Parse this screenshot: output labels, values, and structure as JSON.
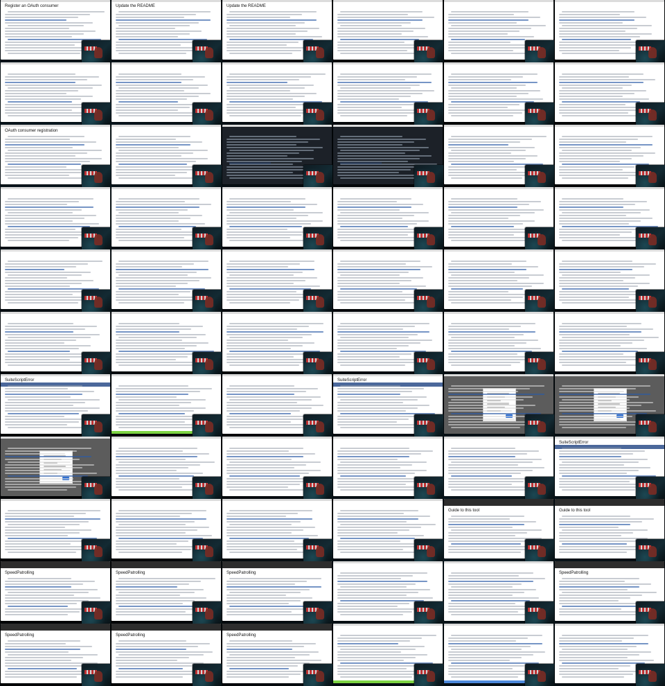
{
  "screen": {
    "label": "Contact sheet of UI screenshots"
  },
  "tiles": [
    {
      "id": "r1c1",
      "title": "Register an OAuth consumer",
      "theme": "light"
    },
    {
      "id": "r1c2",
      "title": "Update the README",
      "theme": "light"
    },
    {
      "id": "r1c3",
      "title": "Update the README",
      "theme": "light"
    },
    {
      "id": "r1c4",
      "title": "",
      "theme": "light"
    },
    {
      "id": "r1c5",
      "title": "",
      "theme": "light"
    },
    {
      "id": "r1c6",
      "title": "",
      "theme": "light"
    },
    {
      "id": "r2c1",
      "title": "",
      "theme": "light"
    },
    {
      "id": "r2c2",
      "title": "",
      "theme": "light"
    },
    {
      "id": "r2c3",
      "title": "",
      "theme": "light"
    },
    {
      "id": "r2c4",
      "title": "",
      "theme": "light"
    },
    {
      "id": "r2c5",
      "title": "",
      "theme": "light"
    },
    {
      "id": "r2c6",
      "title": "",
      "theme": "light"
    },
    {
      "id": "r3c1",
      "title": "OAuth consumer registration",
      "theme": "light"
    },
    {
      "id": "r3c2",
      "title": "",
      "theme": "light"
    },
    {
      "id": "r3c3",
      "title": "",
      "theme": "dark"
    },
    {
      "id": "r3c4",
      "title": "",
      "theme": "dark"
    },
    {
      "id": "r3c5",
      "title": "",
      "theme": "light"
    },
    {
      "id": "r3c6",
      "title": "",
      "theme": "light"
    },
    {
      "id": "r4c1",
      "title": "",
      "theme": "light"
    },
    {
      "id": "r4c2",
      "title": "",
      "theme": "light"
    },
    {
      "id": "r4c3",
      "title": "",
      "theme": "light"
    },
    {
      "id": "r4c4",
      "title": "",
      "theme": "light"
    },
    {
      "id": "r4c5",
      "title": "",
      "theme": "light"
    },
    {
      "id": "r4c6",
      "title": "",
      "theme": "light"
    },
    {
      "id": "r5c1",
      "title": "",
      "theme": "light"
    },
    {
      "id": "r5c2",
      "title": "",
      "theme": "light"
    },
    {
      "id": "r5c3",
      "title": "",
      "theme": "light"
    },
    {
      "id": "r5c4",
      "title": "",
      "theme": "light"
    },
    {
      "id": "r5c5",
      "title": "",
      "theme": "light"
    },
    {
      "id": "r5c6",
      "title": "",
      "theme": "light"
    },
    {
      "id": "r6c1",
      "title": "",
      "theme": "light"
    },
    {
      "id": "r6c2",
      "title": "",
      "theme": "light"
    },
    {
      "id": "r6c3",
      "title": "",
      "theme": "light"
    },
    {
      "id": "r6c4",
      "title": "",
      "theme": "light"
    },
    {
      "id": "r6c5",
      "title": "",
      "theme": "light"
    },
    {
      "id": "r6c6",
      "title": "",
      "theme": "light"
    },
    {
      "id": "r7c1",
      "title": "SuiteScriptError",
      "theme": "light"
    },
    {
      "id": "r7c2",
      "title": "",
      "theme": "light"
    },
    {
      "id": "r7c3",
      "title": "",
      "theme": "light"
    },
    {
      "id": "r7c4",
      "title": "SuiteScriptError",
      "theme": "light"
    },
    {
      "id": "r7c5",
      "title": "",
      "theme": "gray"
    },
    {
      "id": "r7c6",
      "title": "",
      "theme": "gray"
    },
    {
      "id": "r8c1",
      "title": "",
      "theme": "gray"
    },
    {
      "id": "r8c2",
      "title": "",
      "theme": "light"
    },
    {
      "id": "r8c3",
      "title": "",
      "theme": "light"
    },
    {
      "id": "r8c4",
      "title": "",
      "theme": "light"
    },
    {
      "id": "r8c5",
      "title": "",
      "theme": "light"
    },
    {
      "id": "r8c6",
      "title": "SuiteScriptError",
      "theme": "light"
    },
    {
      "id": "r9c1",
      "title": "",
      "theme": "light"
    },
    {
      "id": "r9c2",
      "title": "",
      "theme": "light"
    },
    {
      "id": "r9c3",
      "title": "",
      "theme": "light"
    },
    {
      "id": "r9c4",
      "title": "",
      "theme": "light"
    },
    {
      "id": "r9c5",
      "title": "Guide to this tool",
      "theme": "light"
    },
    {
      "id": "r9c6",
      "title": "Guide to this tool",
      "theme": "light"
    },
    {
      "id": "r10c1",
      "title": "SpeedPatrolling",
      "theme": "light"
    },
    {
      "id": "r10c2",
      "title": "SpeedPatrolling",
      "theme": "light"
    },
    {
      "id": "r10c3",
      "title": "SpeedPatrolling",
      "theme": "light"
    },
    {
      "id": "r10c4",
      "title": "",
      "theme": "light"
    },
    {
      "id": "r10c5",
      "title": "",
      "theme": "light"
    },
    {
      "id": "r10c6",
      "title": "SpeedPatrolling",
      "theme": "light"
    },
    {
      "id": "r11c1",
      "title": "SpeedPatrolling",
      "theme": "light"
    },
    {
      "id": "r11c2",
      "title": "SpeedPatrolling",
      "theme": "light"
    },
    {
      "id": "r11c3",
      "title": "SpeedPatrolling",
      "theme": "light"
    },
    {
      "id": "r11c4",
      "title": "",
      "theme": "light"
    },
    {
      "id": "r11c5",
      "title": "",
      "theme": "light"
    },
    {
      "id": "r11c6",
      "title": "",
      "theme": "light"
    }
  ]
}
